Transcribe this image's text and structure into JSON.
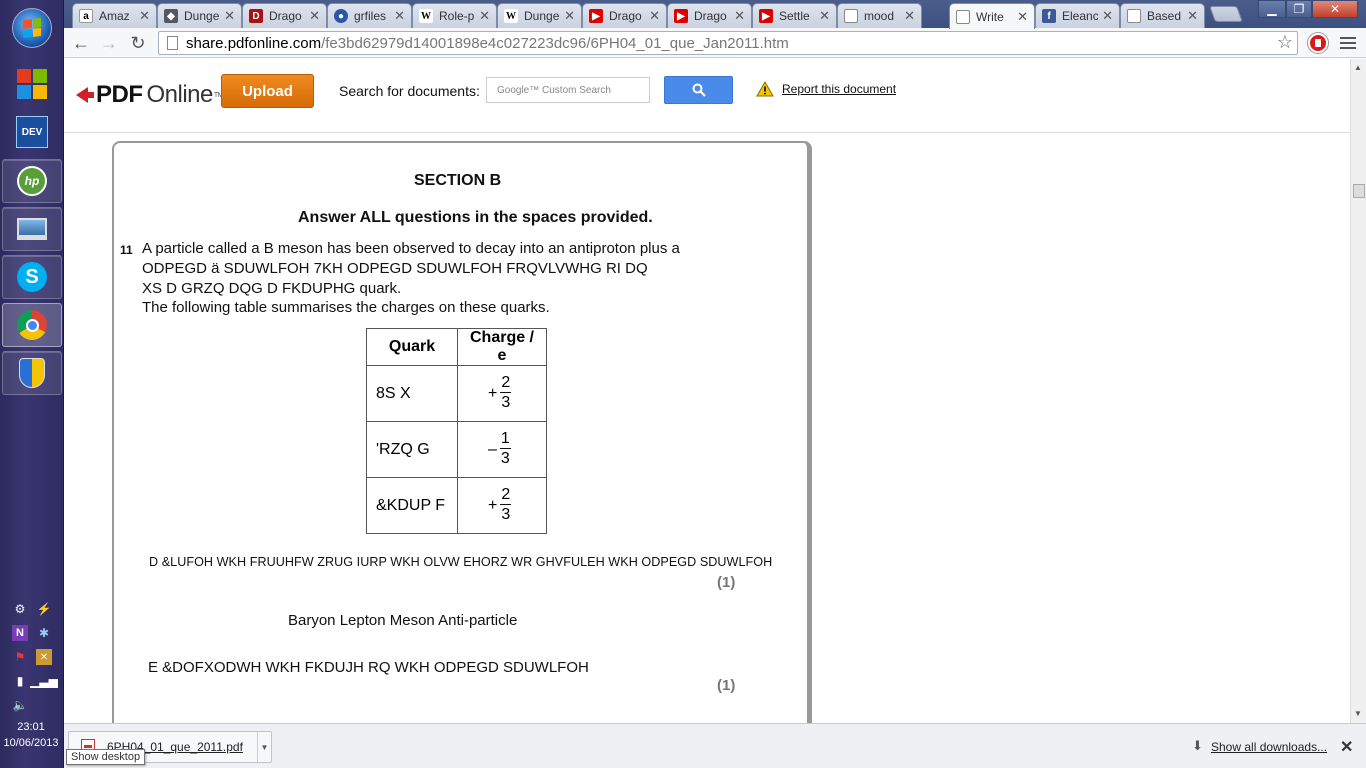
{
  "browser": {
    "tabs": [
      {
        "title": "Amaz",
        "icon": "amazon-icon",
        "active": false
      },
      {
        "title": "Dunge",
        "icon": "dungeon-icon",
        "active": false
      },
      {
        "title": "Drago",
        "icon": "dragon-icon",
        "active": false
      },
      {
        "title": "grfiles",
        "icon": "globe-icon",
        "active": false
      },
      {
        "title": "Role-p",
        "icon": "wikipedia-icon",
        "active": false
      },
      {
        "title": "Dunge",
        "icon": "wikipedia-icon",
        "active": false
      },
      {
        "title": "Drago",
        "icon": "youtube-icon",
        "active": false
      },
      {
        "title": "Drago",
        "icon": "youtube-icon",
        "active": false
      },
      {
        "title": "Settle",
        "icon": "youtube-icon",
        "active": false
      },
      {
        "title": "mood",
        "icon": "page-icon",
        "active": false
      },
      {
        "title": "Write",
        "icon": "page-icon",
        "active": true
      },
      {
        "title": "Eleanc",
        "icon": "facebook-icon",
        "active": false
      },
      {
        "title": "Based",
        "icon": "page-icon",
        "active": false
      }
    ],
    "address": {
      "host": "share.pdfonline.com",
      "path": "/fe3bd62979d14001898e4c027223dc96/6PH04_01_que_Jan2011.htm"
    }
  },
  "site": {
    "logo_pdf": "PDF",
    "logo_online": "Online",
    "logo_tm": "TM",
    "upload_label": "Upload",
    "search_label": "Search for documents:",
    "search_placeholder": "Google™ Custom Search",
    "report_label": "Report this document"
  },
  "document": {
    "section_title": "SECTION B",
    "instruction": "Answer ALL questions in the spaces provided.",
    "question_number": "11",
    "question_lines": [
      "A particle called a B meson has been observed to decay into an antiproton plus a",
      "ODPEGD ä SDUWLFOH 7KH ODPEGD SDUWLFOH FRQVLVWHG RI DQ",
      "XS D GRZQ DQG D FKDUPHG quark.",
      "The following table summarises the charges on these quarks."
    ],
    "table": {
      "headers": [
        "Quark",
        "Charge / e"
      ],
      "rows": [
        {
          "quark": "8S X",
          "sign": "+",
          "num": "2",
          "den": "3"
        },
        {
          "quark": "'RZQ G",
          "sign": "–",
          "num": "1",
          "den": "3"
        },
        {
          "quark": "&KDUP F",
          "sign": "+",
          "num": "2",
          "den": "3"
        }
      ]
    },
    "part_a": "D &LUFOH WKH FRUUHFW ZRUG IURP WKH OLVW EHORZ WR GHVFULEH WKH ODPEGD SDUWLFOH",
    "part_a_mark": "(1)",
    "options_line": "Baryon Lepton Meson Anti-particle",
    "part_b": "E &DOFXODWH WKH FKDUJH RQ WKH ODPEGD SDUWLFOH",
    "part_b_mark": "(1)"
  },
  "downloads": {
    "file_name": "6PH04_01_que_2011.pdf",
    "show_all": "Show all downloads..."
  },
  "taskbar": {
    "time": "23:01",
    "date": "10/06/2013",
    "tooltip": "Show desktop"
  }
}
